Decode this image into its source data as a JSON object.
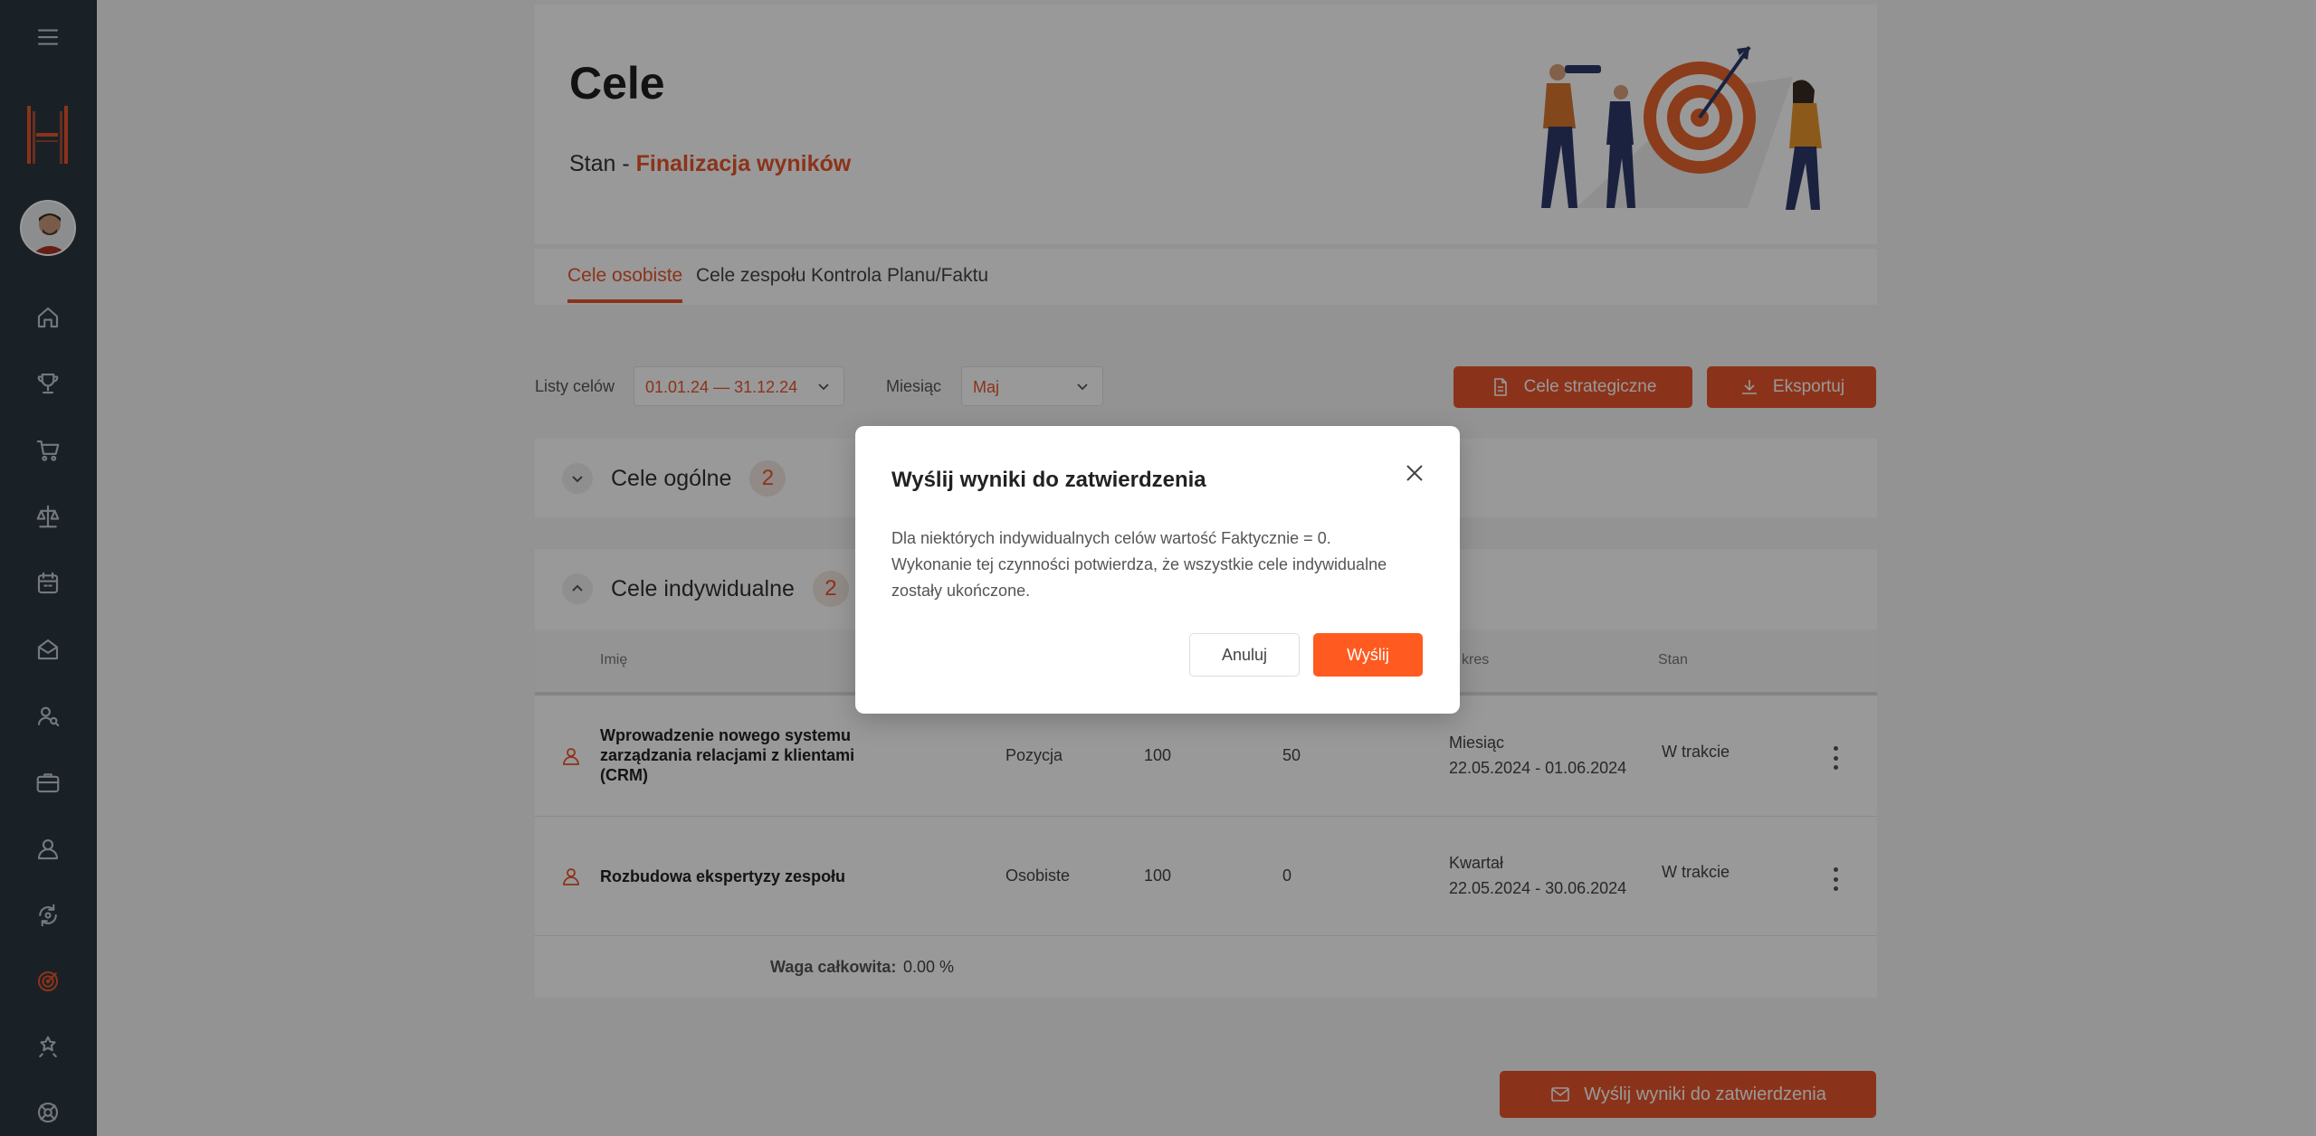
{
  "header": {
    "title": "Cele",
    "status_prefix": "Stan - ",
    "status_value": "Finalizacja wyników"
  },
  "tabs": [
    {
      "label": "Cele osobiste",
      "active": true
    },
    {
      "label": "Cele zespołu",
      "active": false
    },
    {
      "label": "Kontrola Planu/Faktu",
      "active": false
    }
  ],
  "filters": {
    "goal_lists_label": "Listy celów",
    "goal_lists_value": "01.01.24 — 31.12.24",
    "month_label": "Miesiąc",
    "month_value": "Maj"
  },
  "actions": {
    "strategic_label": "Cele strategiczne",
    "export_label": "Eksportuj",
    "send_results_label": "Wyślij wyniki do zatwierdzenia"
  },
  "sections": {
    "general": {
      "title": "Cele ogólne",
      "count": "2"
    },
    "individual": {
      "title": "Cele indywidualne",
      "count": "2"
    }
  },
  "table": {
    "headers": {
      "name": "Imię",
      "period": "kres",
      "status": "Stan"
    },
    "rows": [
      {
        "name": "Wprowadzenie nowego systemu zarządzania relacjami z klientami (CRM)",
        "type": "Pozycja",
        "plan": "100",
        "fact": "50",
        "period_type": "Miesiąc",
        "period_range": "22.05.2024 - 01.06.2024",
        "status": "W trakcie"
      },
      {
        "name": "Rozbudowa ekspertyzy zespołu",
        "type": "Osobiste",
        "plan": "100",
        "fact": "0",
        "period_type": "Kwartał",
        "period_range": "22.05.2024 - 30.06.2024",
        "status": "W trakcie"
      }
    ],
    "total_label": "Waga całkowita:",
    "total_value": "0.00 %"
  },
  "modal": {
    "title": "Wyślij wyniki do zatwierdzenia",
    "body_line1": "Dla niektórych indywidualnych celów wartość Faktycznie = 0.",
    "body_line2": "Wykonanie tej czynności potwierdza, że wszystkie cele indywidualne",
    "body_line3": "zostały ukończone.",
    "cancel_label": "Anuluj",
    "confirm_label": "Wyślij"
  },
  "colors": {
    "accent": "#e8562c",
    "sidebar": "#2c3740",
    "confirm": "#ff5a1f"
  }
}
